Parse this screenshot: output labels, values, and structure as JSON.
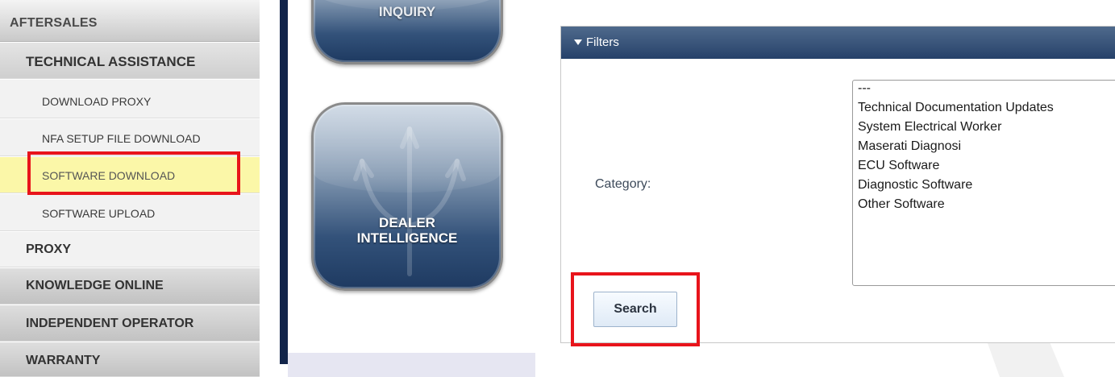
{
  "sidebar": {
    "header": "AFTERSALES",
    "items": [
      {
        "label": "TECHNICAL ASSISTANCE"
      },
      {
        "label": "DOWNLOAD PROXY"
      },
      {
        "label": "NFA SETUP FILE DOWNLOAD"
      },
      {
        "label": "SOFTWARE DOWNLOAD"
      },
      {
        "label": "SOFTWARE UPLOAD"
      },
      {
        "label": "PROXY"
      },
      {
        "label": "KNOWLEDGE ONLINE"
      },
      {
        "label": "INDEPENDENT OPERATOR"
      },
      {
        "label": "WARRANTY"
      }
    ]
  },
  "tiles": {
    "top_label": "INQUIRY",
    "dealer": {
      "line1": "DEALER",
      "line2": "INTELLIGENCE"
    }
  },
  "filters": {
    "title": "Filters",
    "category_label": "Category:",
    "options": [
      "---",
      "Technical Documentation Updates",
      "System Electrical Worker",
      "Maserati Diagnosi",
      "ECU Software",
      "Diagnostic Software",
      "Other Software"
    ],
    "search_label": "Search"
  },
  "colors": {
    "highlight_row": "#fbf7a8",
    "annotation_red": "#e8141b",
    "panel_header": "#26416a",
    "rail": "#12244a"
  },
  "icons": [
    "collapse-arrow-icon",
    "trident-logo-icon"
  ]
}
